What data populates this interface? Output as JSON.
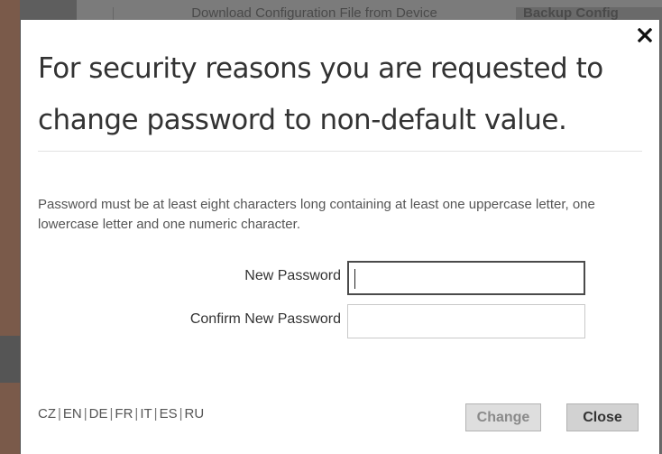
{
  "background": {
    "tab_download": "Download Configuration File from Device",
    "tab_backup": "Backup Config"
  },
  "dialog": {
    "title": "For security reasons you are requested to change password to non-default value.",
    "close_symbol": "✕",
    "info": "Password must be at least eight characters long containing at least one uppercase letter, one lowercase letter and one numeric character.",
    "fields": {
      "new_password": {
        "label": "New Password",
        "value": ""
      },
      "confirm_password": {
        "label": "Confirm New Password",
        "value": ""
      }
    },
    "languages": [
      "CZ",
      "EN",
      "DE",
      "FR",
      "IT",
      "ES",
      "RU"
    ],
    "buttons": {
      "change": "Change",
      "close": "Close"
    }
  }
}
